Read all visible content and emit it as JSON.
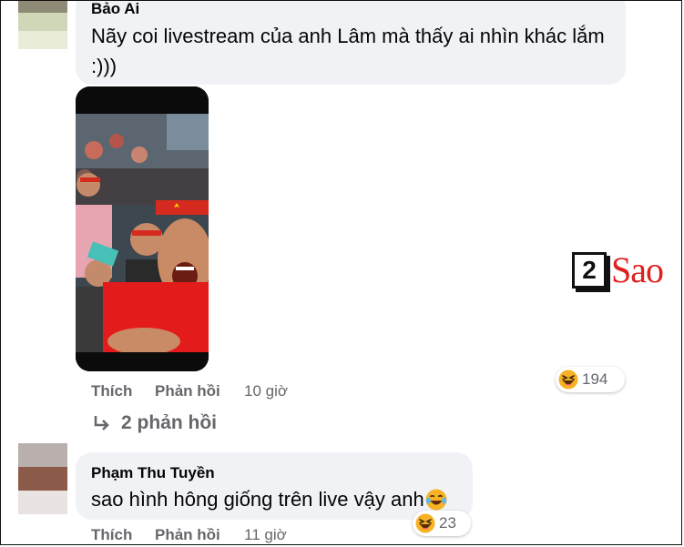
{
  "comments": [
    {
      "author": "Bảo Ai",
      "text_line1": "Nãy coi livestream của anh Lâm mà thấy ai nhìn khác lắm",
      "text_line2": ":)))",
      "actions": {
        "like": "Thích",
        "reply": "Phản hồi",
        "time": "10 giờ"
      },
      "reaction": {
        "icon": "haha-icon",
        "count": "194"
      },
      "replies_link": "2 phản hồi",
      "avatar_colors": [
        "#8e8a76",
        "#cfd7b8",
        "#e8ecd9"
      ]
    },
    {
      "author": "Phạm Thu Tuyền",
      "text": "sao hình hông giống trên live vậy anh",
      "actions": {
        "like": "Thích",
        "reply": "Phản hồi",
        "time": "11 giờ"
      },
      "reaction": {
        "icon": "haha-icon",
        "count": "23"
      },
      "avatar_colors": [
        "#b9afac",
        "#8c5a49",
        "#e9e3e1"
      ]
    }
  ],
  "watermark": {
    "badge": "2",
    "text": "Sao"
  },
  "colors": {
    "bubble": "#f0f2f5",
    "secondary_text": "#65676b",
    "haha": "#f7b125",
    "watermark_red": "#e02020"
  }
}
